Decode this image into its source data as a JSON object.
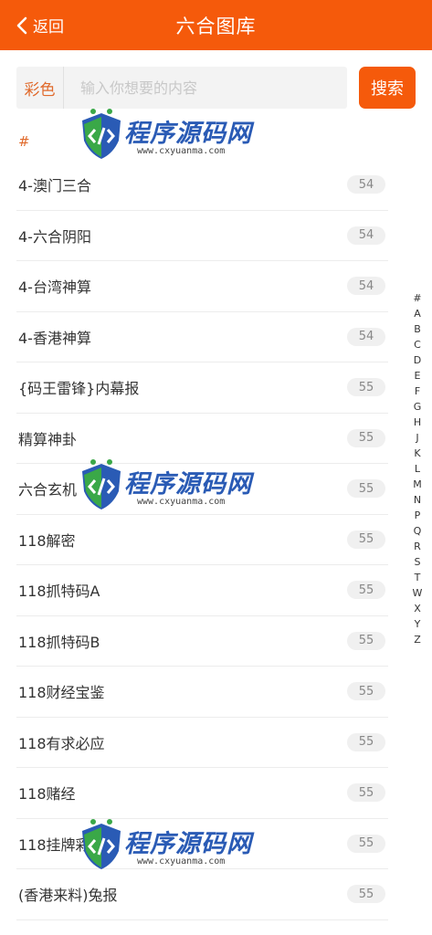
{
  "header": {
    "back_label": "返回",
    "title": "六合图库"
  },
  "search": {
    "category": "彩色",
    "placeholder": "输入你想要的内容",
    "button_label": "搜索"
  },
  "section": {
    "header": "#"
  },
  "items": [
    {
      "label": "4-澳门三合",
      "count": "54"
    },
    {
      "label": "4-六合阴阳",
      "count": "54"
    },
    {
      "label": "4-台湾神算",
      "count": "54"
    },
    {
      "label": "4-香港神算",
      "count": "54"
    },
    {
      "label": "{码王雷锋}内幕报",
      "count": "55"
    },
    {
      "label": "精算神卦",
      "count": "55"
    },
    {
      "label": "六合玄机",
      "count": "55"
    },
    {
      "label": "118解密",
      "count": "55"
    },
    {
      "label": "118抓特码A",
      "count": "55"
    },
    {
      "label": "118抓特码B",
      "count": "55"
    },
    {
      "label": "118财经宝鉴",
      "count": "55"
    },
    {
      "label": "118有求必应",
      "count": "55"
    },
    {
      "label": "118赌经",
      "count": "55"
    },
    {
      "label": "118挂牌彩图",
      "count": "55"
    },
    {
      "label": "(香港来料)兔报",
      "count": "55"
    }
  ],
  "index": [
    "#",
    "A",
    "B",
    "C",
    "D",
    "E",
    "F",
    "G",
    "H",
    "J",
    "K",
    "L",
    "M",
    "N",
    "P",
    "Q",
    "R",
    "S",
    "T",
    "W",
    "X",
    "Y",
    "Z"
  ],
  "watermark": {
    "text": "程序源码网",
    "url": "www.cxyuanma.com"
  },
  "colors": {
    "accent": "#f55a0b",
    "category_text": "#e06a2c",
    "watermark_blue": "#2a5bb5",
    "watermark_green": "#3aa848"
  },
  "icons": {
    "back": "chevron-left-icon",
    "watermark_logo": "code-shield-icon"
  }
}
